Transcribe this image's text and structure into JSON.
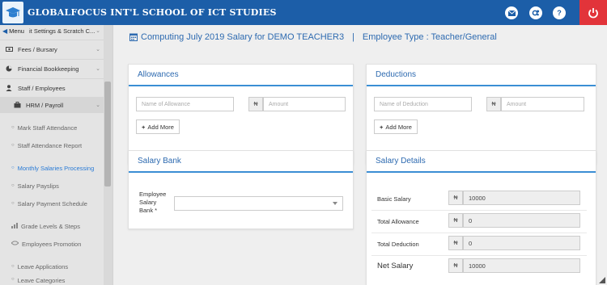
{
  "app": {
    "school_name": "GLOBALFOCUS INT'L SCHOOL OF ICT STUDIES",
    "brand_color": "#1c5ea8",
    "power_color": "#e2343a"
  },
  "topbar": {
    "icons": [
      "envelope-icon",
      "settings-icon",
      "help-icon",
      "power-icon"
    ],
    "help_glyph": "?"
  },
  "sidebar": {
    "menu_label": "Menu",
    "truncated_item": "it Settings & Scratch C...",
    "items": [
      {
        "label": "Fees / Bursary",
        "icon": "money-icon"
      },
      {
        "label": "Financial Bookkeeping",
        "icon": "pie-chart-icon"
      },
      {
        "label": "Staff / Employees",
        "icon": "user-icon"
      },
      {
        "label": "HRM / Payroll",
        "icon": "briefcase-icon"
      }
    ],
    "sub_items": [
      {
        "label": "Mark Staff Attendance"
      },
      {
        "label": "Staff Attendance Report"
      },
      {
        "label": "Monthly Salaries Processing",
        "active": true
      },
      {
        "label": "Salary Payslips"
      },
      {
        "label": "Salary Payment Schedule"
      },
      {
        "label": "Grade Levels & Steps"
      },
      {
        "label": "Employees Promotion"
      },
      {
        "label": "Leave Applications"
      },
      {
        "label": "Leave Categories"
      }
    ],
    "active_color": "#2a7bd6"
  },
  "header": {
    "title": "Computing July 2019 Salary for DEMO TEACHER3",
    "separator": "|",
    "employee_type": "Employee Type : Teacher/General"
  },
  "allowances": {
    "title": "Allowances",
    "name_placeholder": "Name of Allowance",
    "currency": "₦",
    "amount_placeholder": "Amount",
    "add_more": "Add More"
  },
  "deductions": {
    "title": "Deductions",
    "name_placeholder": "Name of Deduction",
    "currency": "₦",
    "amount_placeholder": "Amount",
    "add_more": "Add More"
  },
  "salary_bank": {
    "title": "Salary Bank",
    "label_line1": "Employee",
    "label_line2": "Salary",
    "label_line3": "Bank *",
    "selected": ""
  },
  "salary_details": {
    "title": "Salary Details",
    "currency": "₦",
    "rows": [
      {
        "label": "Basic Salary",
        "value": "10000"
      },
      {
        "label": "Total Allowance",
        "value": "0"
      },
      {
        "label": "Total Deduction",
        "value": "0"
      },
      {
        "label": "Net Salary",
        "value": "10000"
      }
    ]
  }
}
